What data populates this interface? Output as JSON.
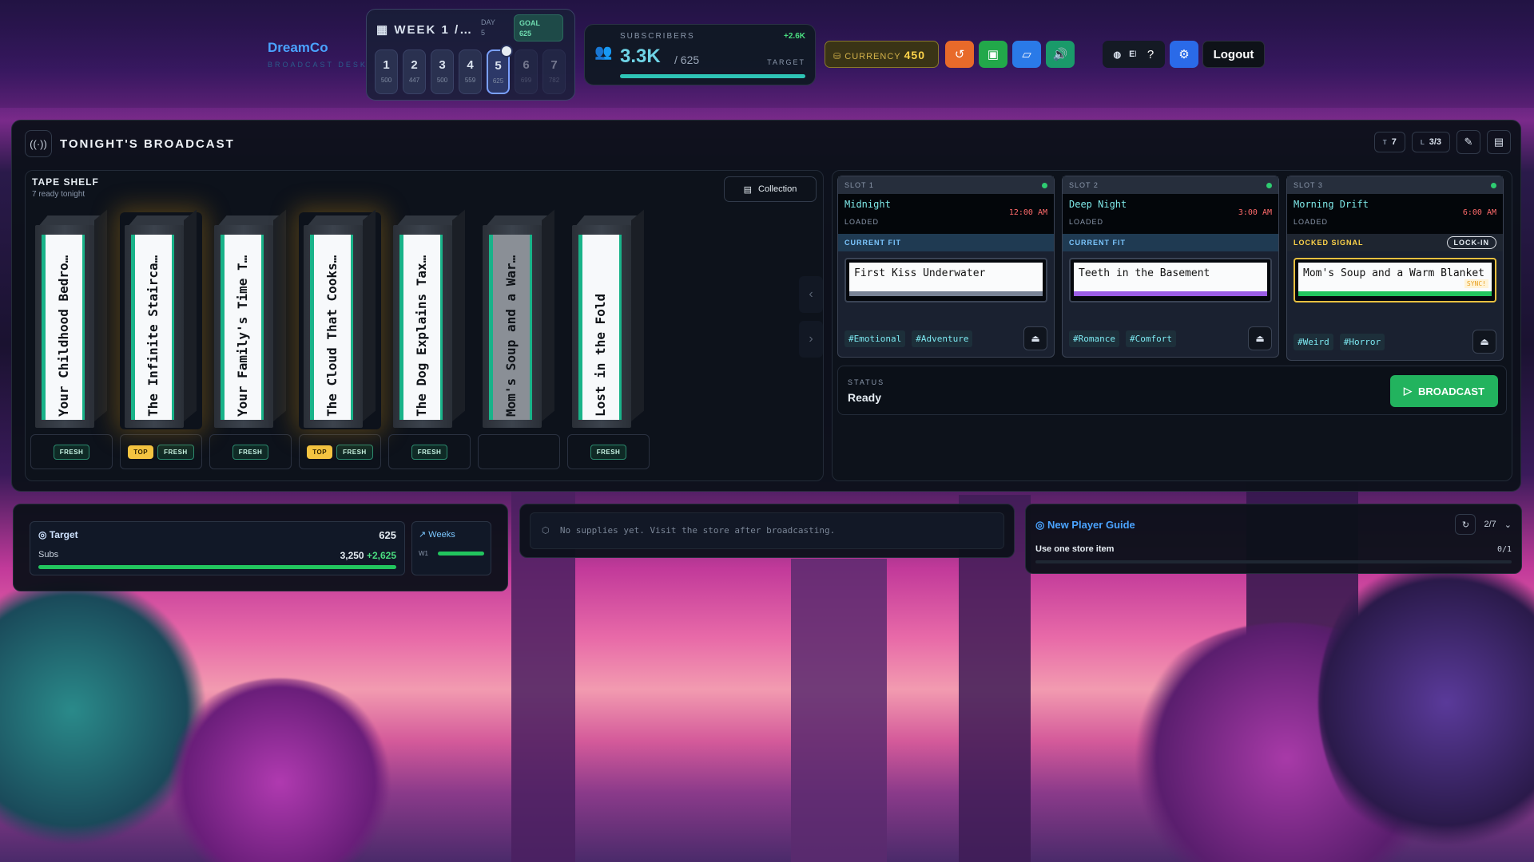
{
  "header": {
    "logo_title": "DreamCo",
    "logo_subtitle": "BROADCAST DESK",
    "week_label": "WEEK 1 /…",
    "day_label": "DAY",
    "day_value": "5",
    "goal_label": "GOAL",
    "goal_value": "625",
    "days": [
      {
        "n": "1",
        "v": "500"
      },
      {
        "n": "2",
        "v": "447"
      },
      {
        "n": "3",
        "v": "500"
      },
      {
        "n": "4",
        "v": "559"
      },
      {
        "n": "5",
        "v": "625"
      },
      {
        "n": "6",
        "v": "699"
      },
      {
        "n": "7",
        "v": "782"
      }
    ],
    "active_day": "5",
    "subscribers_label": "SUBSCRIBERS",
    "subscribers_value": "3.3K",
    "subscribers_target": "/ 625",
    "subscribers_delta": "+2.6K",
    "target_label": "TARGET",
    "subscribers_progress": 1.0,
    "currency_label": "CURRENCY",
    "currency_value": "450",
    "lang": "EN",
    "logout": "Logout"
  },
  "main": {
    "title": "TONIGHT'S BROADCAST",
    "chip_t_label": "T",
    "chip_t_value": "7",
    "chip_l_label": "L",
    "chip_l_value": "3/3"
  },
  "shelf": {
    "title": "TAPE SHELF",
    "subtitle": "7 ready tonight",
    "collection": "Collection",
    "tapes": [
      {
        "title": "Your Childhood Bedro…",
        "badges": [
          "FRESH"
        ]
      },
      {
        "title": "The Infinite Staircа…",
        "badges": [
          "TOP",
          "FRESH"
        ]
      },
      {
        "title": "Your Family's Time T…",
        "badges": [
          "FRESH"
        ]
      },
      {
        "title": "The Cloud That Cooks…",
        "badges": [
          "TOP",
          "FRESH"
        ]
      },
      {
        "title": "The Dog Explains Tax…",
        "badges": [
          "FRESH"
        ]
      },
      {
        "title": "Mom's Soup and a War…",
        "badges": []
      },
      {
        "title": "Lost in the Fold",
        "badges": [
          "FRESH"
        ]
      }
    ]
  },
  "slots": [
    {
      "label": "SLOT 1",
      "name": "Midnight",
      "time": "12:00 AM",
      "state": "LOADED",
      "fit": "CURRENT FIT",
      "tape": "First Kiss Underwater",
      "tape_color": "#7a8496",
      "tags": [
        "#Emotional",
        "#Adventure"
      ]
    },
    {
      "label": "SLOT 2",
      "name": "Deep Night",
      "time": "3:00 AM",
      "state": "LOADED",
      "fit": "CURRENT FIT",
      "tape": "Teeth in the Basement",
      "tape_color": "#9b5de5",
      "tags": [
        "#Romance",
        "#Comfort"
      ]
    },
    {
      "label": "SLOT 3",
      "name": "Morning Drift",
      "time": "6:00 AM",
      "state": "LOADED",
      "fit": "LOCKED SIGNAL",
      "lockin": "LOCK-IN",
      "tape": "Mom's Soup and a Warm Blanket",
      "tape_color": "#22c55e",
      "sync": "SYNC!",
      "tags": [
        "#Weird",
        "#Horror"
      ]
    }
  ],
  "status": {
    "label": "STATUS",
    "value": "Ready",
    "broadcast": "BROADCAST"
  },
  "target": {
    "title": "Target",
    "value": "625",
    "subs_label": "Subs",
    "subs_value": "3,250",
    "subs_delta": "+2,625",
    "progress": 1.0,
    "weeks_label": "Weeks",
    "week_row": "W1"
  },
  "supplies": {
    "empty": "No supplies yet. Visit the store after broadcasting."
  },
  "guide": {
    "title": "New Player Guide",
    "step": "2/7",
    "task": "Use one store item",
    "progress": "0/1"
  }
}
